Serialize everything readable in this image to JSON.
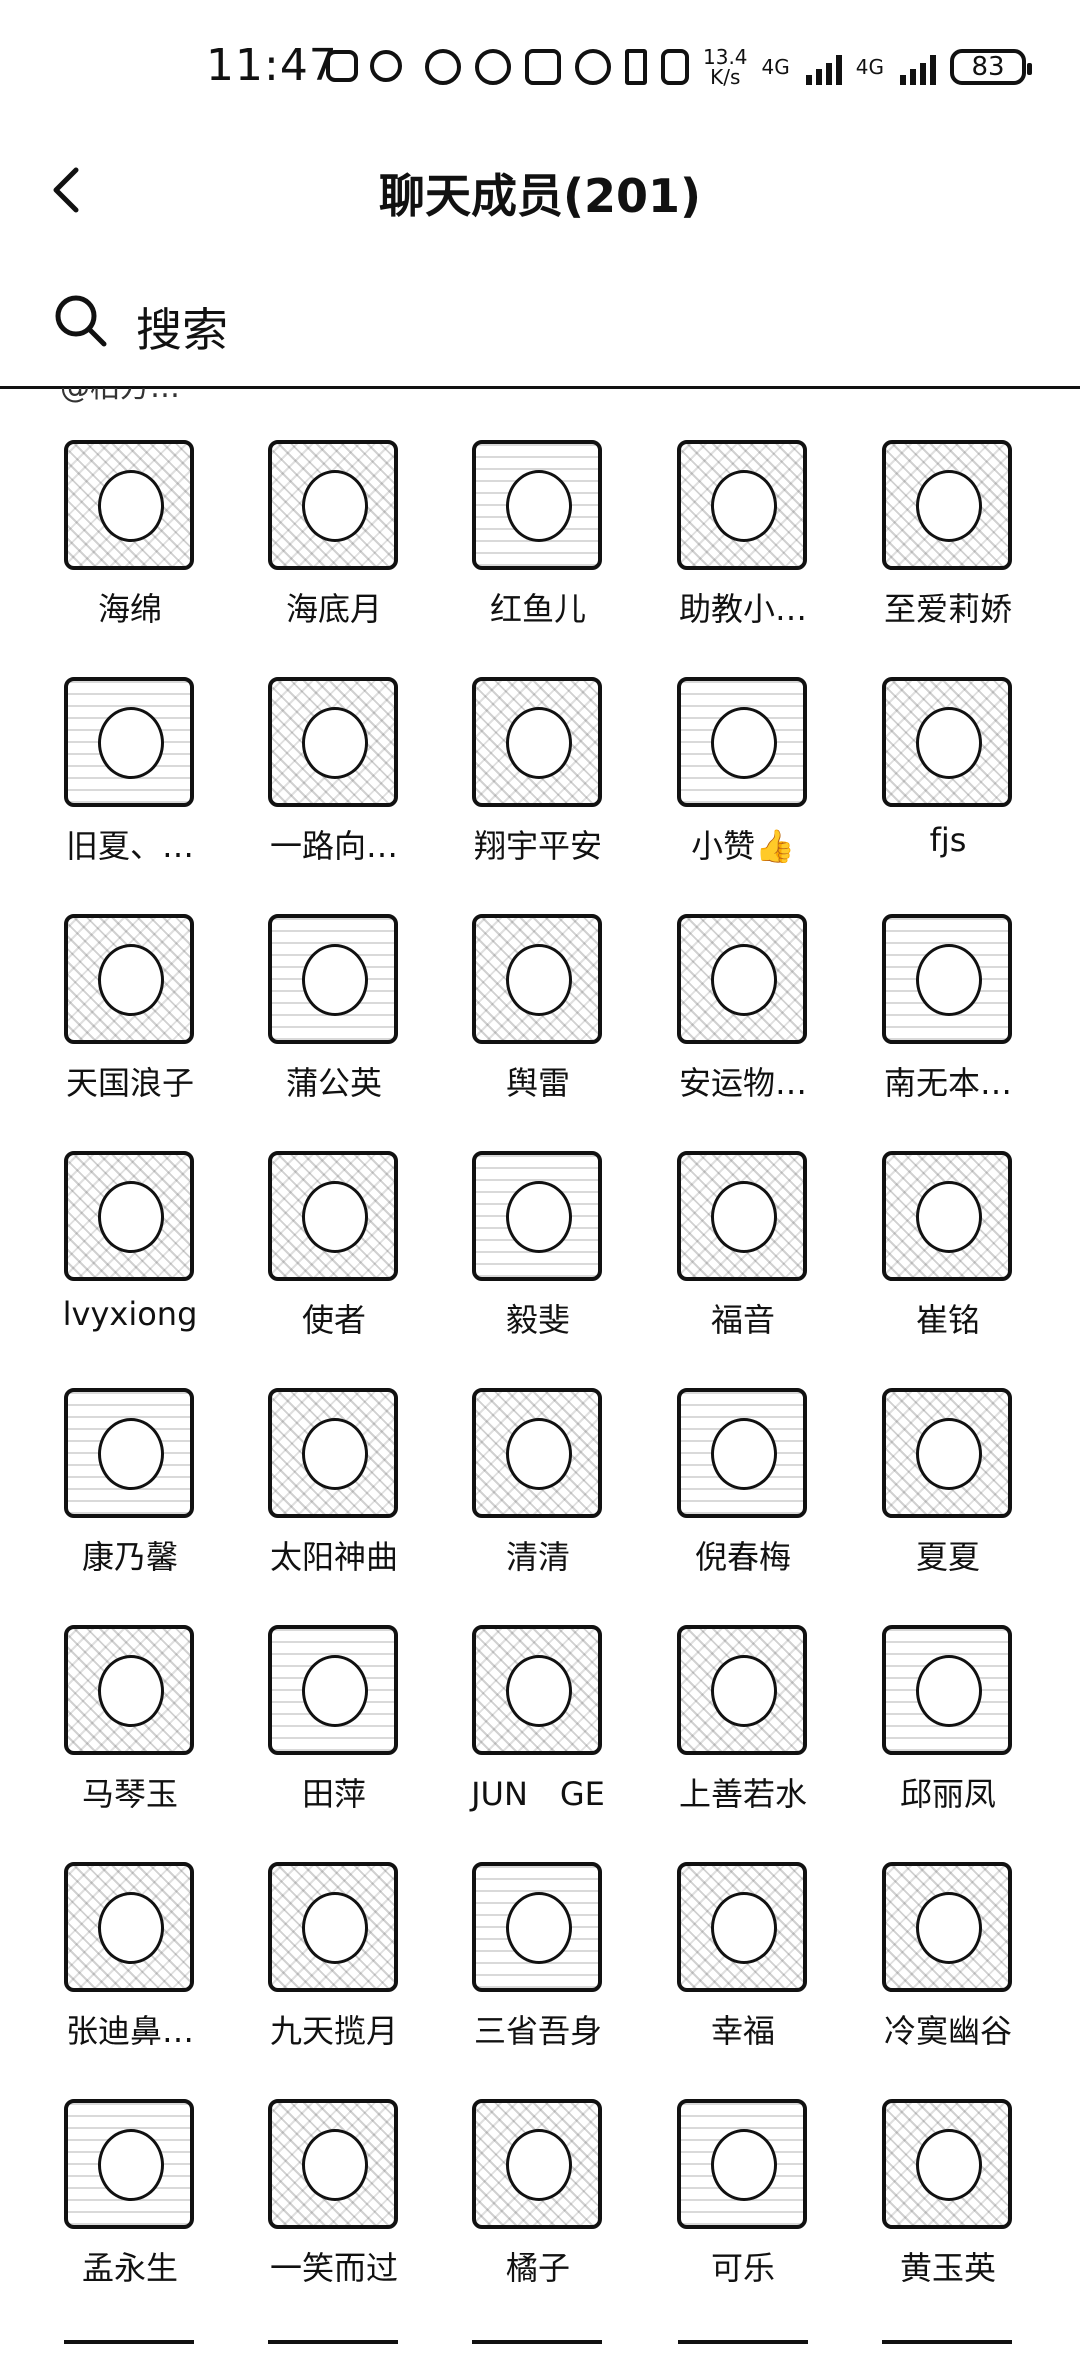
{
  "status_bar": {
    "time": "11:47",
    "net_speed_top": "13.4",
    "net_speed_bottom": "K/s",
    "net1": "4G",
    "net2": "4G",
    "battery": "83"
  },
  "header": {
    "title": "聊天成员(201)"
  },
  "search": {
    "placeholder": "搜索"
  },
  "members": {
    "cut_off_label": "@柏方…",
    "items": [
      "海绵",
      "海底月",
      "红鱼儿",
      "助教小…",
      "至爱莉娇",
      "旧夏、…",
      "一路向…",
      "翔宇平安",
      "小赞👍",
      "fjs",
      "天国浪子",
      "蒲公英",
      "舆雷",
      "安运物…",
      "南无本…",
      "lvyxiong",
      "使者",
      "毅斐",
      "福音",
      "崔铭",
      "康乃馨",
      "太阳神曲",
      "清清",
      "倪春梅",
      "夏夏",
      "马琴玉",
      "田萍",
      "JUN　GE",
      "上善若水",
      "邱丽凤",
      "张迪鼻…",
      "九天揽月",
      "三省吾身",
      "幸福",
      "冷寞幽谷",
      "孟永生",
      "一笑而过",
      "橘子",
      "可乐",
      "黄玉英"
    ]
  }
}
